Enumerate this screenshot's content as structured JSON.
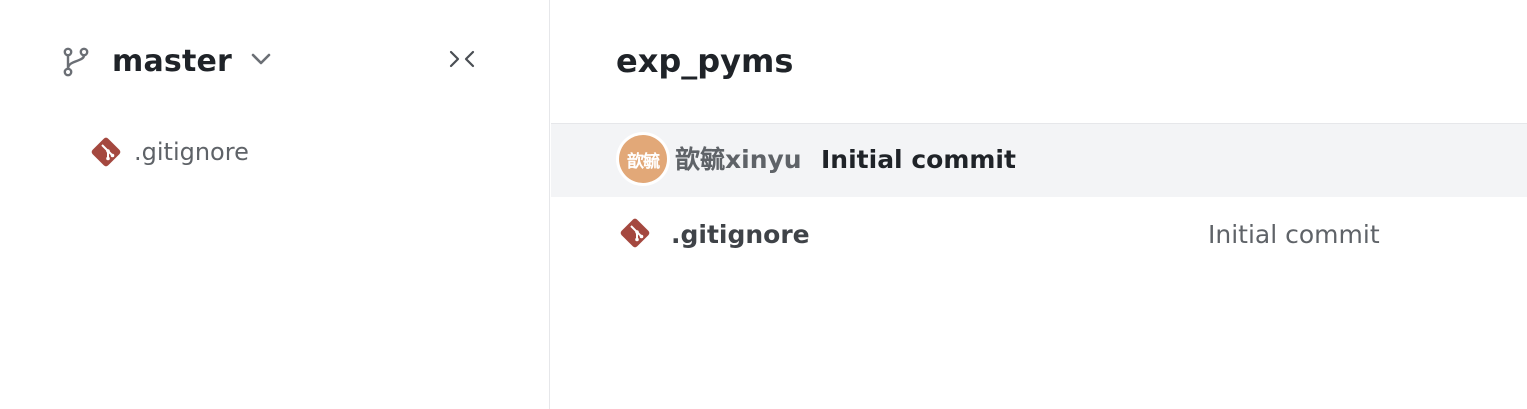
{
  "sidebar": {
    "branch": {
      "icon": "git-branch-icon",
      "name": "master",
      "dropdown_icon": "chevron-down-icon"
    },
    "collapse_icon": "collapse-panel-icon",
    "tree": [
      {
        "icon": "git-file-icon",
        "label": ".gitignore"
      }
    ]
  },
  "main": {
    "repo_title": "exp_pyms",
    "latest_commit": {
      "avatar_text": "歆毓",
      "avatar_color": "#e2a878",
      "author": "歆毓xinyu",
      "message": "Initial commit"
    },
    "files": [
      {
        "icon": "git-file-icon",
        "name": ".gitignore",
        "last_commit": "Initial commit"
      }
    ]
  },
  "colors": {
    "git_icon": "#a4483f",
    "row_highlight": "#f3f4f6",
    "border": "#e6e7ea"
  }
}
